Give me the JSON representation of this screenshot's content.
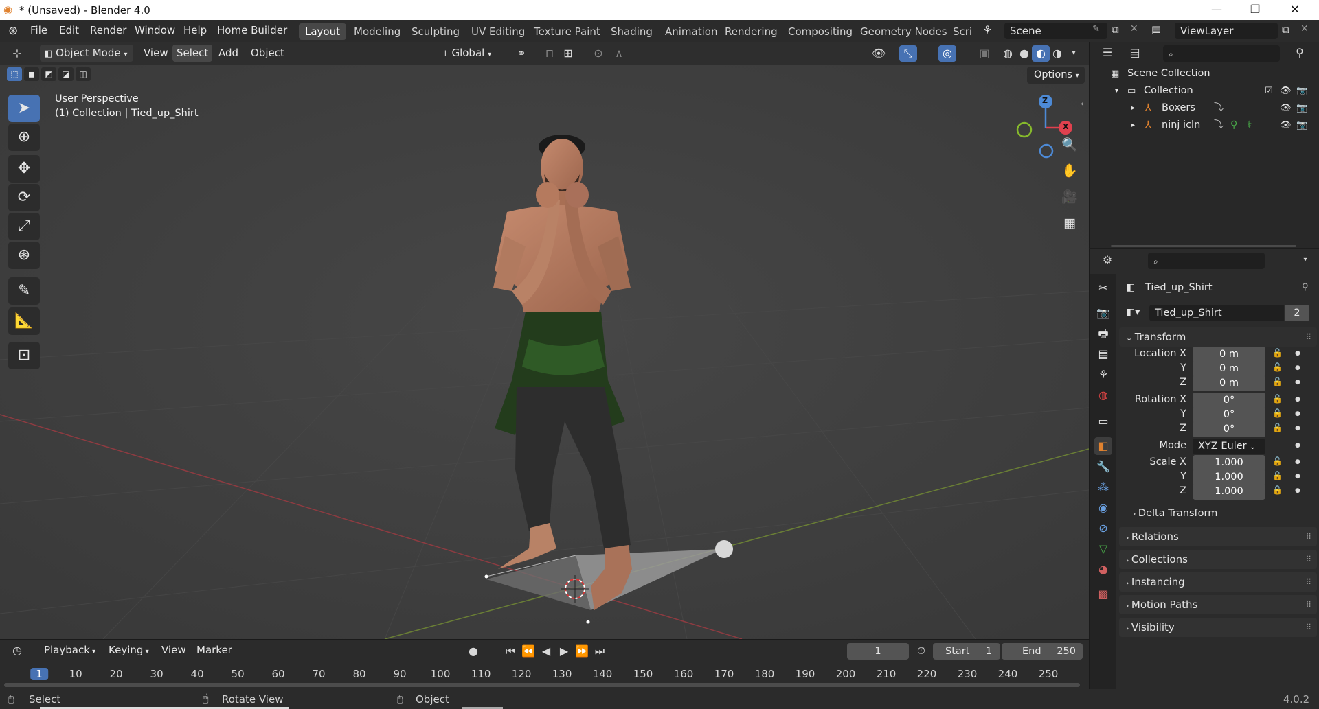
{
  "window": {
    "title": "* (Unsaved) - Blender 4.0"
  },
  "menus": [
    "File",
    "Edit",
    "Render",
    "Window",
    "Help",
    "Home Builder"
  ],
  "workspaces": [
    "Layout",
    "Modeling",
    "Sculpting",
    "UV Editing",
    "Texture Paint",
    "Shading",
    "Animation",
    "Rendering",
    "Compositing",
    "Geometry Nodes",
    "Scri"
  ],
  "scene": "Scene",
  "view_layer": "ViewLayer",
  "viewport_header": {
    "mode": "Object Mode",
    "menus": [
      "View",
      "Select",
      "Add",
      "Object"
    ],
    "orientation": "Global",
    "options": "Options"
  },
  "viewport": {
    "perspective": "User Perspective",
    "collection_info": "(1) Collection | Tied_up_Shirt"
  },
  "gizmo": {
    "z": "Z",
    "x": "X"
  },
  "outliner": {
    "root": "Scene Collection",
    "collection": "Collection",
    "items": [
      "Boxers",
      "ninj icln"
    ]
  },
  "properties": {
    "object_name": "Tied_up_Shirt",
    "datablock_name": "Tied_up_Shirt",
    "users": "2",
    "transform_title": "Transform",
    "location": {
      "label": "Location X",
      "x": "0 m",
      "y": "0 m",
      "z": "0 m"
    },
    "rotation": {
      "label": "Rotation X",
      "x": "0°",
      "y": "0°",
      "z": "0°"
    },
    "mode_label": "Mode",
    "mode_value": "XYZ Euler",
    "scale": {
      "label": "Scale X",
      "x": "1.000",
      "y": "1.000",
      "z": "1.000"
    },
    "axis_y": "Y",
    "axis_z": "Z",
    "delta": "Delta Transform",
    "panels": [
      "Relations",
      "Collections",
      "Instancing",
      "Motion Paths",
      "Visibility"
    ]
  },
  "timeline": {
    "menus": [
      "Playback",
      "Keying",
      "View",
      "Marker"
    ],
    "current_frame": "1",
    "start_label": "Start",
    "start": "1",
    "end_label": "End",
    "end": "250",
    "ticks": [
      "1",
      "10",
      "20",
      "30",
      "40",
      "50",
      "60",
      "70",
      "80",
      "90",
      "100",
      "110",
      "120",
      "130",
      "140",
      "150",
      "160",
      "170",
      "180",
      "190",
      "200",
      "210",
      "220",
      "230",
      "240",
      "250"
    ]
  },
  "status": {
    "select": "Select",
    "rotate": "Rotate View",
    "object": "Object",
    "version": "4.0.2"
  },
  "colors": {
    "accent": "#4772b3",
    "x_axis": "#e0414e",
    "y_axis": "#86b92c",
    "z_axis": "#4d8ad6",
    "object_orange": "#e0822f"
  }
}
